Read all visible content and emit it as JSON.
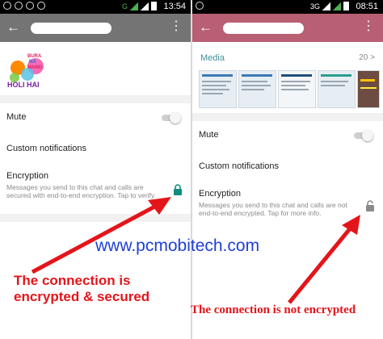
{
  "left_phone": {
    "status": {
      "time": "13:54",
      "net": "G"
    },
    "toolbar": {
      "back_icon": "back-arrow-icon",
      "menu_icon": "kebab-menu-icon"
    },
    "logo": {
      "line1": "BURA",
      "line2": "NA",
      "line3": "MANO",
      "line4": "HOLI HAI"
    },
    "mute_label": "Mute",
    "custom_notifications_label": "Custom notifications",
    "encryption": {
      "label": "Encryption",
      "description": "Messages you send to this chat and calls are secured with end-to-end encryption. Tap to verify.",
      "icon": "lock-closed-icon"
    }
  },
  "right_phone": {
    "status": {
      "time": "08:51",
      "net": "3G"
    },
    "toolbar": {
      "back_icon": "back-arrow-icon",
      "menu_icon": "kebab-menu-icon"
    },
    "media": {
      "title": "Media",
      "count": "20 >"
    },
    "mute_label": "Mute",
    "custom_notifications_label": "Custom notifications",
    "encryption": {
      "label": "Encryption",
      "description": "Messages you send to this chat and calls are not end-to-end encrypted. Tap for more info.",
      "icon": "lock-open-icon"
    }
  },
  "overlay": {
    "website": "www.pcmobitech.com",
    "caption_left": "The connection is encrypted & secured",
    "caption_right": "The connection is not encrypted"
  },
  "colors": {
    "left_toolbar": "#747474",
    "right_toolbar": "#b85f73",
    "lock_green": "#128c7e",
    "caption_red": "#e4151a",
    "website_blue": "#1e3fd8"
  }
}
